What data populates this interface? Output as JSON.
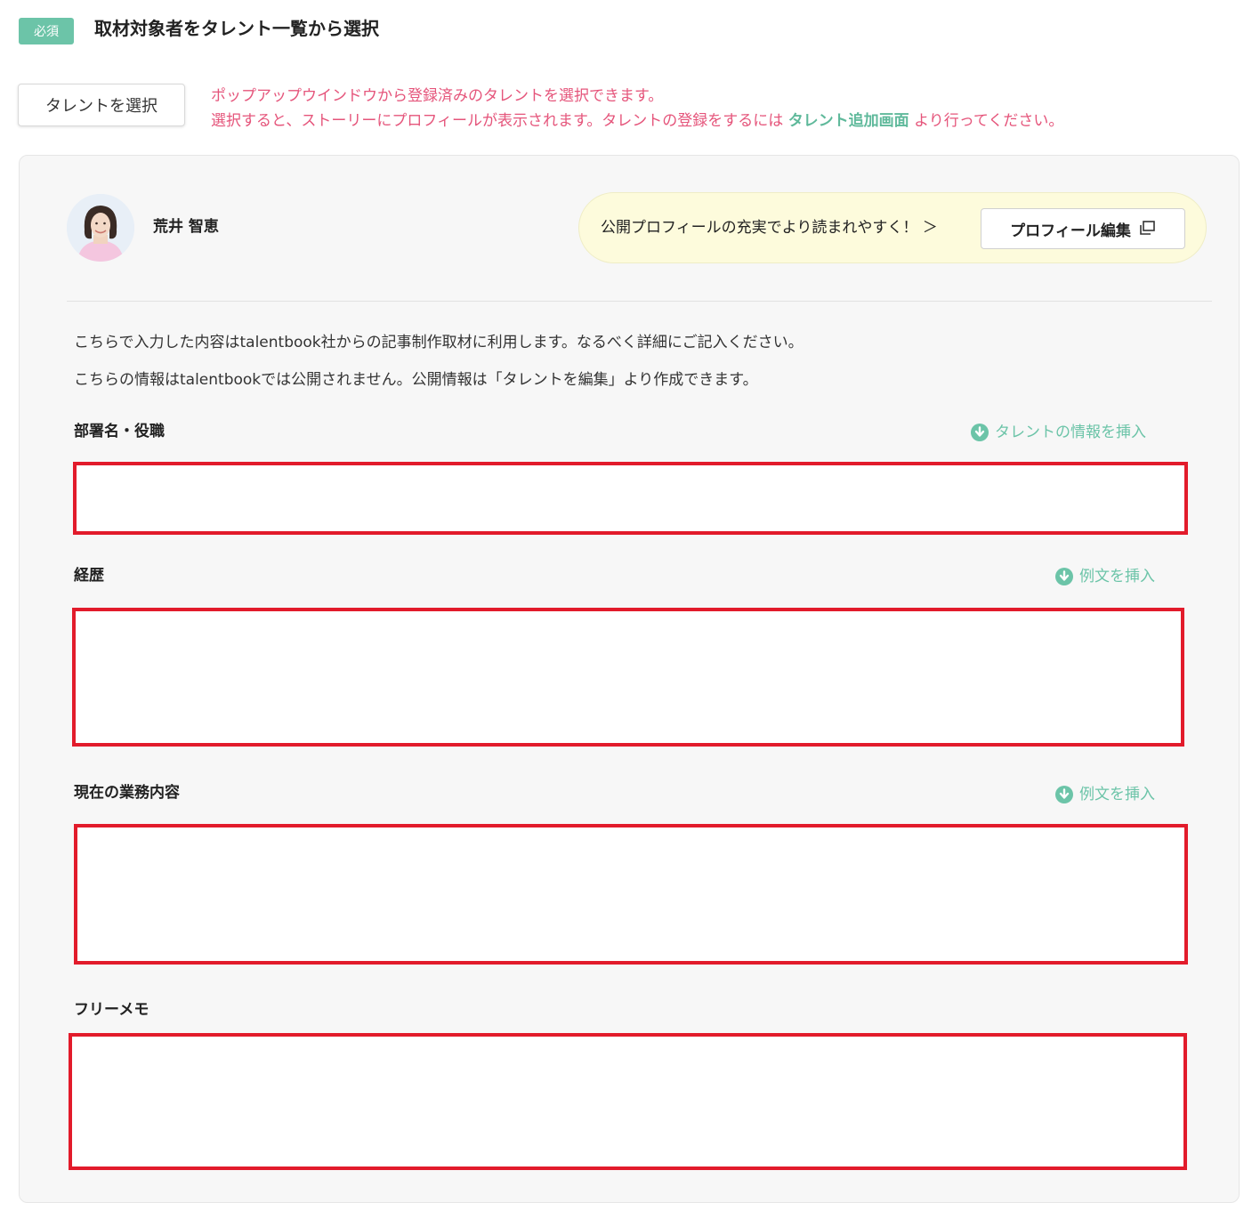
{
  "header": {
    "required_badge": "必須",
    "title": "取材対象者をタレント一覧から選択"
  },
  "select_button": {
    "label": "タレントを選択"
  },
  "notice": {
    "line1": "ポップアップウインドウから登録済みのタレントを選択できます。",
    "line2_prefix": "選択すると、ストーリーにプロフィールが表示されます。タレントの登録をするには",
    "line2_link": "タレント追加画面",
    "line2_suffix": "より行ってください。",
    "color": "#e5557b",
    "link_color": "#5fb99b"
  },
  "talent": {
    "name": "荒井 智恵"
  },
  "promo": {
    "text": "公開プロフィールの充実でより読まれやすく！ ＞",
    "button_label": "プロフィール編集",
    "button_icon": "external-window-icon"
  },
  "info": {
    "line1": "こちらで入力した内容はtalentbook社からの記事制作取材に利用します。なるべく詳細にご記入ください。",
    "line2": "こちらの情報はtalentbookでは公開されません。公開情報は「タレントを編集」より作成できます。"
  },
  "fields": {
    "department": {
      "label": "部署名・役職",
      "insert_label": "タレントの情報を挿入",
      "value": "",
      "placeholder": ""
    },
    "career": {
      "label": "経歴",
      "insert_label": "例文を挿入",
      "value": "",
      "placeholder": ""
    },
    "current_work": {
      "label": "現在の業務内容",
      "insert_label": "例文を挿入",
      "value": "",
      "placeholder": ""
    },
    "free_memo": {
      "label": "フリーメモ",
      "value": "",
      "placeholder": ""
    }
  },
  "colors": {
    "accent": "#6cc4a8",
    "highlight_border": "#e21b2b",
    "promo_bg": "#fdfbdc"
  }
}
